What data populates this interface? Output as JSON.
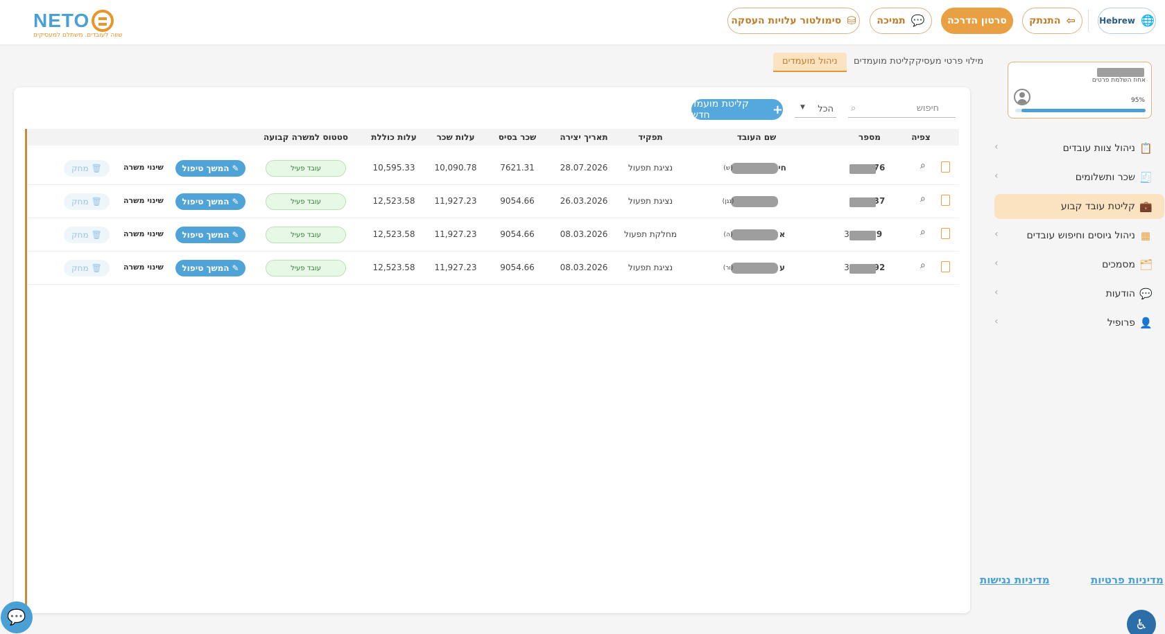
{
  "header": {
    "logo_text": "NETO",
    "logo_tagline": "שווה לעובדים. משתלם למעסיקים",
    "simulator_label": "סימולטור עלויות העסקה",
    "support_label": "תמיכה",
    "tutorial_label": "סרטון הדרכה",
    "logout_label": "התנתק",
    "language_label": "Hebrew"
  },
  "profile": {
    "subtitle": "אחוז השלמת פרטים",
    "completion_percent": 95,
    "completion_text": "95%"
  },
  "sidebar": {
    "items": [
      {
        "label": "ניהול צוות עובדים",
        "icon": "clipboard-icon",
        "has_chevron": true,
        "active": false
      },
      {
        "label": "שכר ותשלומים",
        "icon": "payslip-icon",
        "has_chevron": true,
        "active": false
      },
      {
        "label": "קליטת עובד קבוע",
        "icon": "briefcase-icon",
        "has_chevron": false,
        "active": true
      },
      {
        "label": "ניהול גיוסים וחיפוש עובדים",
        "icon": "grid-plus-icon",
        "has_chevron": true,
        "active": false
      },
      {
        "label": "מסמכים",
        "icon": "documents-icon",
        "has_chevron": true,
        "active": false
      },
      {
        "label": "הודעות",
        "icon": "chat-icon",
        "has_chevron": true,
        "active": false
      },
      {
        "label": "פרופיל",
        "icon": "user-circle-icon",
        "has_chevron": true,
        "active": false
      }
    ],
    "privacy_link": "מדיניות פרטיות",
    "accessibility_link": "מדיניות נגישות"
  },
  "tabs": {
    "employer_details": "מילוי פרטי מעסיק",
    "candidate_intake": "קליטת מועמדים",
    "candidate_management": "ניהול מועמדים"
  },
  "toolbar": {
    "search_placeholder": "חיפוש",
    "filter_value": "הכל",
    "new_candidate_label": "קליטת מועמד חדש"
  },
  "table": {
    "columns": {
      "view": "צפיה",
      "number": "מספר",
      "employee_name": "שם העובד",
      "role": "תפקיד",
      "created_date": "תאריך יצירה",
      "base_salary": "שכר בסיס",
      "salary_cost": "עלות שכר",
      "total_cost": "עלות כוללת",
      "status": "סטטוס למשרה קבועה"
    },
    "actions": {
      "continue": "המשך טיפול",
      "change_position": "שינוי משרה",
      "delete": "מחק"
    },
    "rows": [
      {
        "number_suffix": "76",
        "name_start": "חי",
        "name_end": "(ש)",
        "role": "נציגת תפעול",
        "created": "28.07.2026",
        "base_salary": "7621.31",
        "salary_cost": "10,090.78",
        "total_cost": "10,595.33",
        "status": "עובד פעיל"
      },
      {
        "number_suffix": "37",
        "name_start": "",
        "name_end": "(נגן)",
        "role": "נציגת תפעול",
        "created": "26.03.2026",
        "base_salary": "9054.66",
        "salary_cost": "11,927.23",
        "total_cost": "12,523.58",
        "status": "עובד פעיל"
      },
      {
        "number_suffix": "9",
        "number_prefix": "3",
        "name_start": "א",
        "name_end": "(ה)",
        "role": "מחלקת תפעול",
        "created": "08.03.2026",
        "base_salary": "9054.66",
        "salary_cost": "11,927.23",
        "total_cost": "12,523.58",
        "status": "עובד פעיל"
      },
      {
        "number_suffix": "92",
        "number_prefix": "3",
        "name_start": "ע",
        "name_end": "(ור)",
        "role": "נציגת תפעול",
        "created": "08.03.2026",
        "base_salary": "9054.66",
        "salary_cost": "11,927.23",
        "total_cost": "12,523.58",
        "status": "עובד פעיל"
      }
    ]
  },
  "colors": {
    "brand_blue": "#4a9fd4",
    "brand_orange": "#e8952c",
    "active_bg": "#fbe3c2"
  }
}
